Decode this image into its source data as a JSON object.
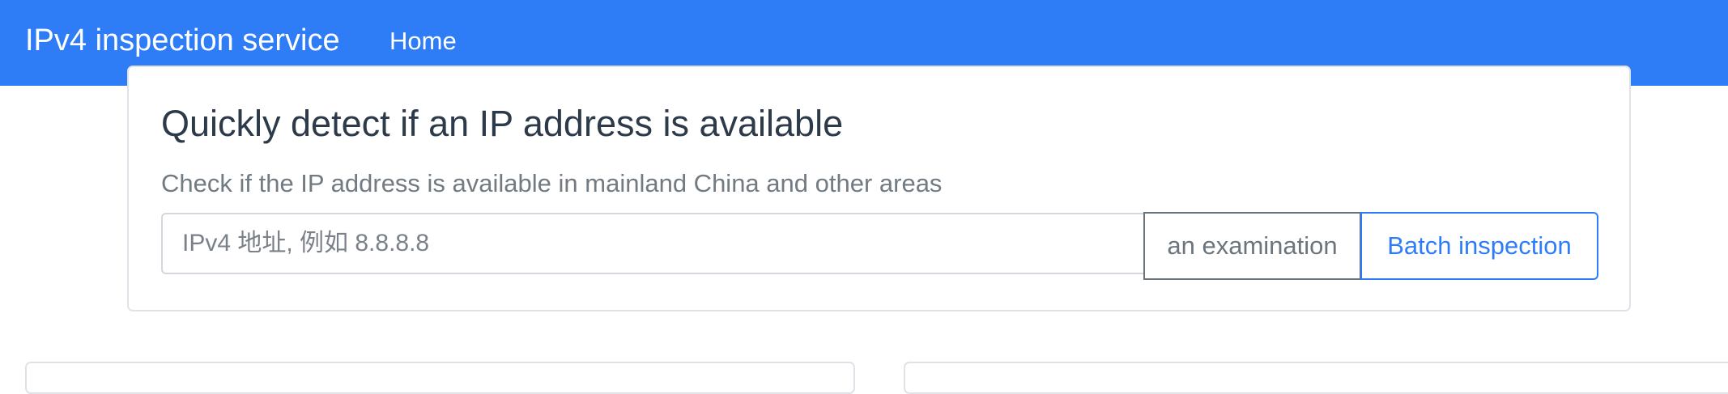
{
  "navbar": {
    "brand": "IPv4 inspection service",
    "links": [
      {
        "label": "Home"
      }
    ],
    "color": "#2f7df6"
  },
  "main_card": {
    "title": "Quickly detect if an IP address is available",
    "subtitle": "Check if the IP address is available in mainland China and other areas",
    "input": {
      "value": "",
      "placeholder": "IPv4 地址, 例如 8.8.8.8"
    },
    "buttons": {
      "examination_label": "an examination",
      "batch_label": "Batch inspection"
    }
  },
  "colors": {
    "accent": "#2f7df6",
    "secondary": "#6c757d",
    "title_text": "#2d3a4a",
    "muted_text": "#727a82"
  }
}
